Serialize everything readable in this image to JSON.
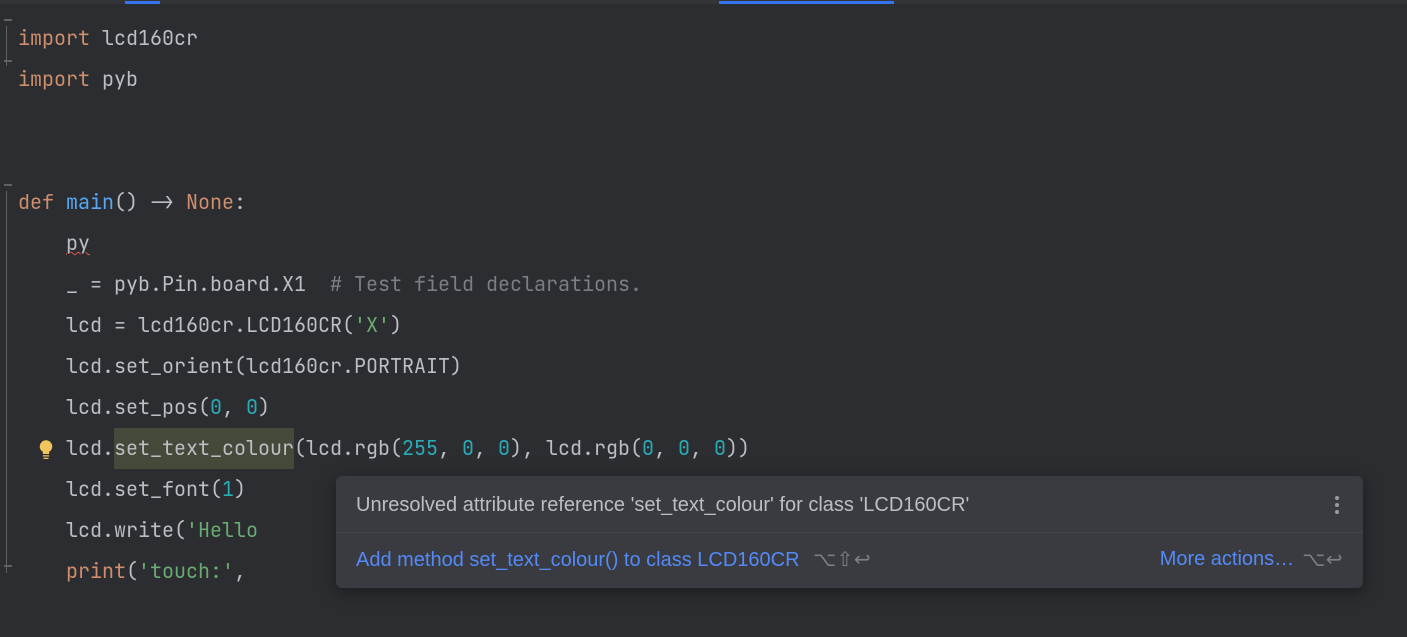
{
  "code": {
    "line1": {
      "kw": "import",
      "mod": "lcd160cr"
    },
    "line2": {
      "kw": "import",
      "mod": "pyb"
    },
    "line5": {
      "kw": "def",
      "name": "main",
      "paren": "()",
      "arrow": " -> ",
      "ret": "None",
      "colon": ":"
    },
    "line6": {
      "text": "py"
    },
    "line7": {
      "pre": "_ = pyb.Pin.board.X1  ",
      "comment": "# Test field declarations."
    },
    "line8": {
      "pre": "lcd = lcd160cr.LCD160CR(",
      "str": "'X'",
      "post": ")"
    },
    "line9": {
      "pre": "lcd.set_orient(lcd160cr.PORTRAIT)"
    },
    "line10": {
      "pre": "lcd.set_pos(",
      "n1": "0",
      "c": ", ",
      "n2": "0",
      "post": ")"
    },
    "line11": {
      "pre": "lcd.",
      "warn": "set_text_colour",
      "mid1": "(lcd.rgb(",
      "n1": "255",
      "c1": ", ",
      "n2": "0",
      "c2": ", ",
      "n3": "0",
      "mid2": "), lcd.rgb(",
      "n4": "0",
      "c3": ", ",
      "n5": "0",
      "c4": ", ",
      "n6": "0",
      "post": "))"
    },
    "line12": {
      "pre": "lcd.set_font(",
      "n": "1",
      "post": ")"
    },
    "line13": {
      "pre": "lcd.write(",
      "str": "'Hello"
    },
    "line14": {
      "builtin": "print",
      "pre": "(",
      "str": "'touch:'",
      "post": ","
    }
  },
  "tooltip": {
    "title": "Unresolved attribute reference 'set_text_colour' for class 'LCD160CR'",
    "action": "Add method set_text_colour() to class LCD160CR",
    "shortcut1": "⌥⇧↩",
    "more": "More actions…",
    "shortcut2": "⌥↩"
  }
}
